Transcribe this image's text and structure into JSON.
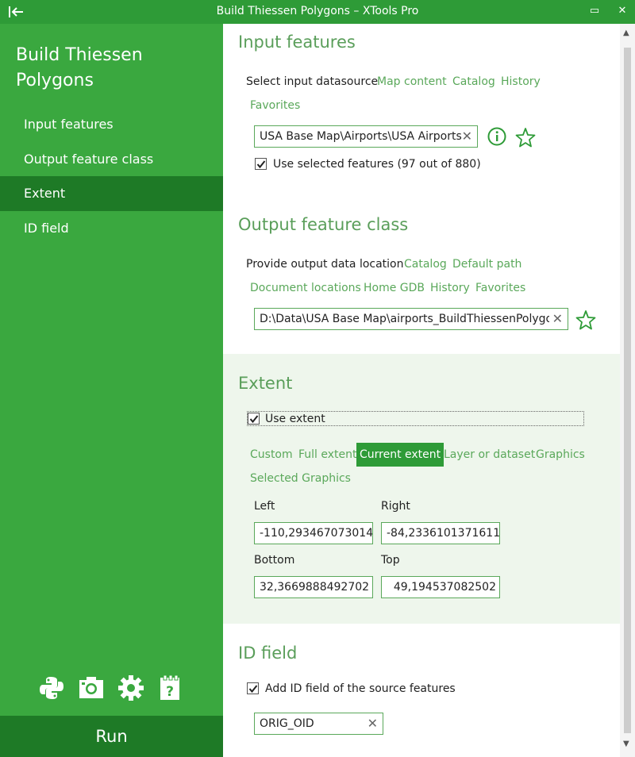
{
  "window": {
    "title": "Build Thiessen Polygons – XTools Pro",
    "maximize_glyph": "▭",
    "close_glyph": "✕"
  },
  "sidebar": {
    "tool_title_line1": "Build Thiessen",
    "tool_title_line2": "Polygons",
    "items": [
      {
        "label": "Input features"
      },
      {
        "label": "Output feature class"
      },
      {
        "label": "Extent"
      },
      {
        "label": "ID field"
      }
    ],
    "active_index": 2,
    "bottom_icons": [
      "python-icon",
      "camera-icon",
      "gear-icon",
      "help-icon"
    ],
    "run_label": "Run"
  },
  "input_features": {
    "title": "Input features",
    "datasource_label": "Select input datasource",
    "links": [
      "Map content",
      "Catalog",
      "History",
      "Favorites"
    ],
    "value": "USA Base Map\\Airports\\USA Airports",
    "use_selected_label": "Use selected features (97 out of 880)",
    "use_selected_checked": true
  },
  "output_feature_class": {
    "title": "Output feature class",
    "location_label": "Provide output data location",
    "links": [
      "Catalog",
      "Default path",
      "Document locations",
      "Home GDB",
      "History",
      "Favorites"
    ],
    "value": "D:\\Data\\USA Base Map\\airports_BuildThiessenPolygo.s"
  },
  "extent": {
    "title": "Extent",
    "use_extent_label": "Use extent",
    "use_extent_checked": true,
    "modes": [
      "Custom",
      "Full extent",
      "Current extent",
      "Layer or dataset",
      "Graphics",
      "Selected Graphics"
    ],
    "selected_mode": "Current extent",
    "left_label": "Left",
    "left_value": "-110,293467073014",
    "right_label": "Right",
    "right_value": "-84,2336101371611",
    "bottom_label": "Bottom",
    "bottom_value": "32,3669888492702",
    "top_label": "Top",
    "top_value": "49,194537082502"
  },
  "id_field": {
    "title": "ID field",
    "add_id_label": "Add ID field of the source features",
    "add_id_checked": true,
    "value": "ORIG_OID"
  },
  "colors": {
    "titlebar": "#2e9b37",
    "sidebar": "#3aa83f",
    "sidebar_active": "#1e7a26",
    "accent_text": "#5a9e5a",
    "link": "#5aa85a",
    "extent_bg": "#eef6ec"
  }
}
